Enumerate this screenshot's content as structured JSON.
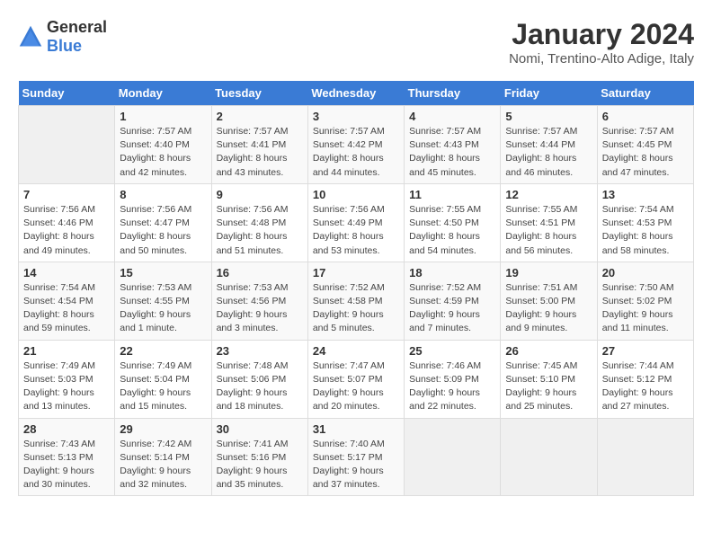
{
  "logo": {
    "general": "General",
    "blue": "Blue"
  },
  "title": "January 2024",
  "subtitle": "Nomi, Trentino-Alto Adige, Italy",
  "days_of_week": [
    "Sunday",
    "Monday",
    "Tuesday",
    "Wednesday",
    "Thursday",
    "Friday",
    "Saturday"
  ],
  "weeks": [
    [
      {
        "day": "",
        "info": ""
      },
      {
        "day": "1",
        "info": "Sunrise: 7:57 AM\nSunset: 4:40 PM\nDaylight: 8 hours\nand 42 minutes."
      },
      {
        "day": "2",
        "info": "Sunrise: 7:57 AM\nSunset: 4:41 PM\nDaylight: 8 hours\nand 43 minutes."
      },
      {
        "day": "3",
        "info": "Sunrise: 7:57 AM\nSunset: 4:42 PM\nDaylight: 8 hours\nand 44 minutes."
      },
      {
        "day": "4",
        "info": "Sunrise: 7:57 AM\nSunset: 4:43 PM\nDaylight: 8 hours\nand 45 minutes."
      },
      {
        "day": "5",
        "info": "Sunrise: 7:57 AM\nSunset: 4:44 PM\nDaylight: 8 hours\nand 46 minutes."
      },
      {
        "day": "6",
        "info": "Sunrise: 7:57 AM\nSunset: 4:45 PM\nDaylight: 8 hours\nand 47 minutes."
      }
    ],
    [
      {
        "day": "7",
        "info": "Sunrise: 7:56 AM\nSunset: 4:46 PM\nDaylight: 8 hours\nand 49 minutes."
      },
      {
        "day": "8",
        "info": "Sunrise: 7:56 AM\nSunset: 4:47 PM\nDaylight: 8 hours\nand 50 minutes."
      },
      {
        "day": "9",
        "info": "Sunrise: 7:56 AM\nSunset: 4:48 PM\nDaylight: 8 hours\nand 51 minutes."
      },
      {
        "day": "10",
        "info": "Sunrise: 7:56 AM\nSunset: 4:49 PM\nDaylight: 8 hours\nand 53 minutes."
      },
      {
        "day": "11",
        "info": "Sunrise: 7:55 AM\nSunset: 4:50 PM\nDaylight: 8 hours\nand 54 minutes."
      },
      {
        "day": "12",
        "info": "Sunrise: 7:55 AM\nSunset: 4:51 PM\nDaylight: 8 hours\nand 56 minutes."
      },
      {
        "day": "13",
        "info": "Sunrise: 7:54 AM\nSunset: 4:53 PM\nDaylight: 8 hours\nand 58 minutes."
      }
    ],
    [
      {
        "day": "14",
        "info": "Sunrise: 7:54 AM\nSunset: 4:54 PM\nDaylight: 8 hours\nand 59 minutes."
      },
      {
        "day": "15",
        "info": "Sunrise: 7:53 AM\nSunset: 4:55 PM\nDaylight: 9 hours\nand 1 minute."
      },
      {
        "day": "16",
        "info": "Sunrise: 7:53 AM\nSunset: 4:56 PM\nDaylight: 9 hours\nand 3 minutes."
      },
      {
        "day": "17",
        "info": "Sunrise: 7:52 AM\nSunset: 4:58 PM\nDaylight: 9 hours\nand 5 minutes."
      },
      {
        "day": "18",
        "info": "Sunrise: 7:52 AM\nSunset: 4:59 PM\nDaylight: 9 hours\nand 7 minutes."
      },
      {
        "day": "19",
        "info": "Sunrise: 7:51 AM\nSunset: 5:00 PM\nDaylight: 9 hours\nand 9 minutes."
      },
      {
        "day": "20",
        "info": "Sunrise: 7:50 AM\nSunset: 5:02 PM\nDaylight: 9 hours\nand 11 minutes."
      }
    ],
    [
      {
        "day": "21",
        "info": "Sunrise: 7:49 AM\nSunset: 5:03 PM\nDaylight: 9 hours\nand 13 minutes."
      },
      {
        "day": "22",
        "info": "Sunrise: 7:49 AM\nSunset: 5:04 PM\nDaylight: 9 hours\nand 15 minutes."
      },
      {
        "day": "23",
        "info": "Sunrise: 7:48 AM\nSunset: 5:06 PM\nDaylight: 9 hours\nand 18 minutes."
      },
      {
        "day": "24",
        "info": "Sunrise: 7:47 AM\nSunset: 5:07 PM\nDaylight: 9 hours\nand 20 minutes."
      },
      {
        "day": "25",
        "info": "Sunrise: 7:46 AM\nSunset: 5:09 PM\nDaylight: 9 hours\nand 22 minutes."
      },
      {
        "day": "26",
        "info": "Sunrise: 7:45 AM\nSunset: 5:10 PM\nDaylight: 9 hours\nand 25 minutes."
      },
      {
        "day": "27",
        "info": "Sunrise: 7:44 AM\nSunset: 5:12 PM\nDaylight: 9 hours\nand 27 minutes."
      }
    ],
    [
      {
        "day": "28",
        "info": "Sunrise: 7:43 AM\nSunset: 5:13 PM\nDaylight: 9 hours\nand 30 minutes."
      },
      {
        "day": "29",
        "info": "Sunrise: 7:42 AM\nSunset: 5:14 PM\nDaylight: 9 hours\nand 32 minutes."
      },
      {
        "day": "30",
        "info": "Sunrise: 7:41 AM\nSunset: 5:16 PM\nDaylight: 9 hours\nand 35 minutes."
      },
      {
        "day": "31",
        "info": "Sunrise: 7:40 AM\nSunset: 5:17 PM\nDaylight: 9 hours\nand 37 minutes."
      },
      {
        "day": "",
        "info": ""
      },
      {
        "day": "",
        "info": ""
      },
      {
        "day": "",
        "info": ""
      }
    ]
  ]
}
